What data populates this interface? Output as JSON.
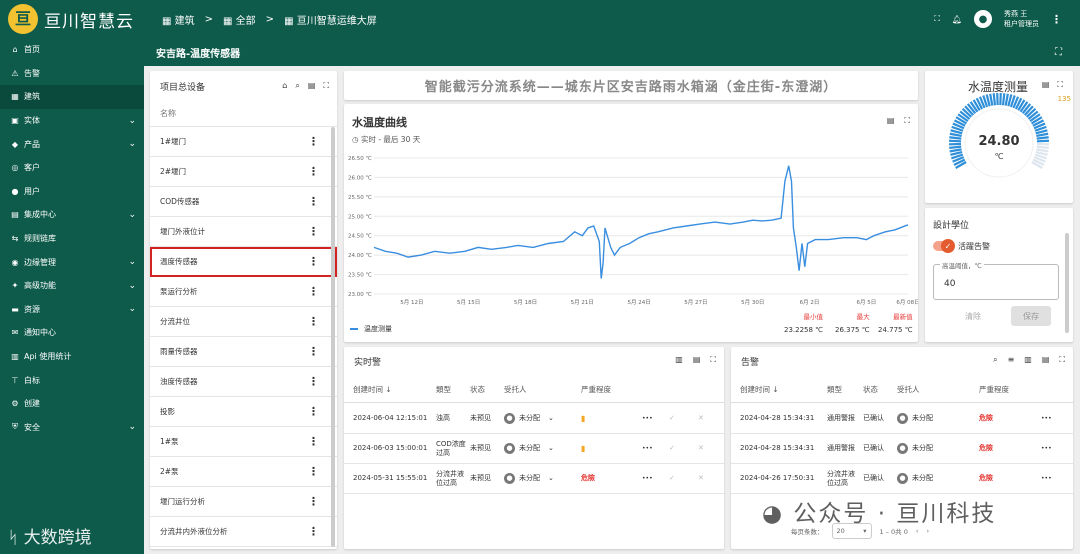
{
  "app": {
    "name": "亘川智慧云",
    "logo_char": "亘"
  },
  "sidebar": {
    "items": [
      {
        "label": "首页",
        "icon": "⌂",
        "chev": ""
      },
      {
        "label": "告警",
        "icon": "⚠",
        "chev": ""
      },
      {
        "label": "建筑",
        "icon": "▦",
        "chev": "",
        "active": true
      },
      {
        "label": "实体",
        "icon": "▣",
        "chev": "⌄"
      },
      {
        "label": "产品",
        "icon": "◆",
        "chev": "⌄"
      },
      {
        "label": "客户",
        "icon": "◎",
        "chev": ""
      },
      {
        "label": "用户",
        "icon": "●",
        "chev": ""
      },
      {
        "label": "集成中心",
        "icon": "▤",
        "chev": "⌄"
      },
      {
        "label": "规则链库",
        "icon": "⇆",
        "chev": ""
      },
      {
        "label": "边缘管理",
        "icon": "◉",
        "chev": "⌄"
      },
      {
        "label": "高级功能",
        "icon": "✦",
        "chev": "⌄"
      },
      {
        "label": "资源",
        "icon": "▬",
        "chev": "⌄"
      },
      {
        "label": "通知中心",
        "icon": "✉",
        "chev": ""
      },
      {
        "label": "Api 使用统计",
        "icon": "▥",
        "chev": ""
      },
      {
        "label": "白标",
        "icon": "⊤",
        "chev": ""
      },
      {
        "label": "创建",
        "icon": "⚙",
        "chev": ""
      },
      {
        "label": "安全",
        "icon": "⛨",
        "chev": "⌄"
      }
    ]
  },
  "watermark_left": "大数跨境",
  "topbar": {
    "crumbs": [
      "建筑",
      "全部",
      "亘川智慧运维大屏"
    ],
    "sep": ">",
    "user_name": "秀燕 王",
    "user_role": "租户管理员",
    "avatar_char": "●"
  },
  "subbar": {
    "title": "安吉路-温度传感器",
    "expand_icon": "⛶"
  },
  "left_panel": {
    "title": "项目总设备",
    "column": "名称",
    "rows": [
      "1#堰门",
      "2#堰门",
      "COD传感器",
      "堰门外液位计",
      "温度传感器",
      "泵运行分析",
      "分流井位",
      "雨量传感器",
      "浊度传感器",
      "投影",
      "1#泵",
      "2#泵",
      "堰门运行分析",
      "分流井内外液位分析"
    ],
    "dots": "⋮"
  },
  "banner": {
    "title": "智能截污分流系统——城东片区安吉路雨水箱涵（金庄街-东澄湖）"
  },
  "chart_panel": {
    "title": "水温度曲线",
    "subtitle": "实时 - 最后 30 天",
    "legend": "温度测量",
    "stats": [
      {
        "label": "最小值",
        "value": "23.2258 ℃"
      },
      {
        "label": "最大",
        "value": "26.375 ℃"
      },
      {
        "label": "最新值",
        "value": "24.775 ℃"
      }
    ]
  },
  "chart_data": {
    "type": "line",
    "title": "水温度曲线",
    "unit": "℃",
    "ylim": [
      23.0,
      26.5
    ],
    "yticks": [
      "26.50 ℃",
      "26.00 ℃",
      "25.50 ℃",
      "25.00 ℃",
      "24.50 ℃",
      "24.00 ℃",
      "23.50 ℃",
      "23.00 ℃"
    ],
    "xticks": [
      "5月 12日",
      "5月 15日",
      "5月 18日",
      "5月 21日",
      "5月 24日",
      "5月 27日",
      "5月 30日",
      "6月 2日",
      "6月 5日",
      "6月 08日"
    ],
    "xrange": [
      10,
      38.2
    ],
    "series": [
      {
        "name": "温度测量",
        "color": "#3a8ee0",
        "points": [
          [
            10.0,
            24.2
          ],
          [
            10.6,
            24.1
          ],
          [
            11.2,
            24.05
          ],
          [
            11.8,
            23.95
          ],
          [
            12.5,
            24.0
          ],
          [
            13.2,
            24.1
          ],
          [
            14.0,
            24.05
          ],
          [
            14.8,
            24.1
          ],
          [
            15.5,
            24.2
          ],
          [
            16.2,
            24.15
          ],
          [
            17.0,
            24.2
          ],
          [
            17.6,
            24.25
          ],
          [
            18.4,
            24.2
          ],
          [
            19.2,
            24.3
          ],
          [
            20.0,
            24.35
          ],
          [
            20.6,
            24.6
          ],
          [
            21.0,
            24.5
          ],
          [
            21.3,
            24.7
          ],
          [
            21.6,
            24.75
          ],
          [
            21.9,
            24.35
          ],
          [
            22.0,
            23.4
          ],
          [
            22.1,
            23.8
          ],
          [
            22.2,
            24.7
          ],
          [
            22.5,
            24.2
          ],
          [
            22.7,
            24.0
          ],
          [
            23.0,
            24.2
          ],
          [
            23.5,
            24.3
          ],
          [
            24.0,
            24.45
          ],
          [
            24.5,
            24.55
          ],
          [
            25.0,
            24.6
          ],
          [
            25.8,
            24.7
          ],
          [
            26.5,
            24.75
          ],
          [
            27.2,
            24.8
          ],
          [
            28.0,
            24.85
          ],
          [
            28.8,
            24.8
          ],
          [
            29.5,
            24.85
          ],
          [
            30.0,
            24.9
          ],
          [
            30.5,
            24.88
          ],
          [
            31.0,
            24.9
          ],
          [
            31.5,
            24.95
          ],
          [
            31.7,
            25.9
          ],
          [
            31.9,
            26.3
          ],
          [
            32.05,
            25.9
          ],
          [
            32.15,
            24.7
          ],
          [
            32.3,
            24.2
          ],
          [
            32.45,
            23.6
          ],
          [
            32.6,
            24.3
          ],
          [
            32.75,
            23.7
          ],
          [
            32.9,
            24.3
          ],
          [
            33.3,
            24.4
          ],
          [
            34.0,
            24.4
          ],
          [
            34.8,
            24.45
          ],
          [
            35.5,
            24.45
          ],
          [
            36.0,
            24.4
          ],
          [
            36.4,
            24.5
          ],
          [
            37.0,
            24.6
          ],
          [
            37.5,
            24.65
          ],
          [
            38.2,
            24.78
          ]
        ]
      }
    ]
  },
  "gauge": {
    "title": "水温度测量",
    "value": "24.80",
    "unit": "℃",
    "fraction": 0.87,
    "color": "#2f8fd8",
    "side_text": "135"
  },
  "settings": {
    "title": "設計學位",
    "toggle_label": "活躍告警",
    "toggle_on": true,
    "field_label": "高温阈值，℃",
    "field_value": "40",
    "clear": "清除",
    "save": "保存",
    "check": "✓"
  },
  "realtime": {
    "title": "实时警",
    "headers": [
      "创建时间 ↓",
      "類型",
      "状态",
      "受托人",
      "严重程度"
    ],
    "rows": [
      {
        "time": "2024-06-04 12:15:01",
        "type": "浊高",
        "status": "未预见",
        "assignee": "未分配",
        "severity": "▮"
      },
      {
        "time": "2024-06-03 15:00:01",
        "type": "COD浓度过高",
        "status": "未预见",
        "assignee": "未分配",
        "severity": "▮"
      },
      {
        "time": "2024-05-31 15:55:01",
        "type": "分流井液位过高",
        "status": "未预见",
        "assignee": "未分配",
        "severity": "危險"
      }
    ]
  },
  "alarms": {
    "title": "告警",
    "headers": [
      "创建时间 ↓",
      "類型",
      "状态",
      "受托人",
      "严重程度"
    ],
    "rows": [
      {
        "time": "2024-04-28 15:34:31",
        "type": "通用警报",
        "status": "已确认",
        "assignee": "未分配",
        "severity": "危險"
      },
      {
        "time": "2024-04-28 15:34:31",
        "type": "通用警报",
        "status": "已确认",
        "assignee": "未分配",
        "severity": "危險"
      },
      {
        "time": "2024-04-26 17:50:31",
        "type": "分流井液位过高",
        "status": "已确认",
        "assignee": "未分配",
        "severity": "危險"
      }
    ],
    "page_size_label": "每页条数：",
    "page_size": "20",
    "range": "1 – 0共 0"
  },
  "watermark_right": "公众号 · 亘川科技"
}
